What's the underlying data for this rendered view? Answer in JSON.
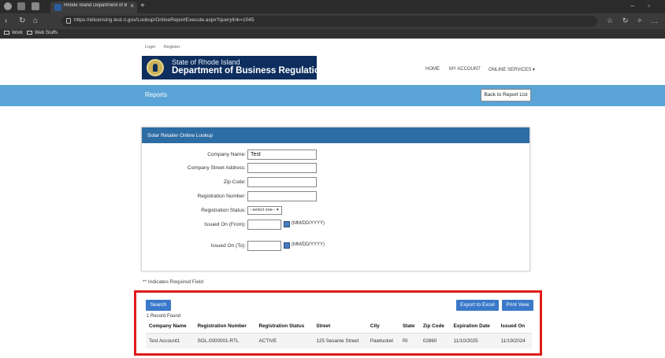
{
  "browser": {
    "tab_title": "Rhode Island Department of Busi",
    "url": "https://elicensing.test.ri.gov/Lookup/OnlineReportExecute.aspx?querylink=1045",
    "favorites": [
      "Work",
      "Web Stuffs"
    ]
  },
  "header": {
    "top_links": [
      "Login",
      "Register"
    ],
    "logo_line1": "State of Rhode Island",
    "logo_line2": "Department of Business Regulation",
    "nav": [
      "HOME",
      "MY ACCOUNT",
      "ONLINE SERVICES ▾"
    ]
  },
  "banner": {
    "title": "Reports",
    "back_label": "Back to Report List"
  },
  "form": {
    "heading": "Solar Retailer Online Lookup",
    "company_name_label": "Company Name:",
    "company_name_value": "Test",
    "street_label": "Company Street Address:",
    "zip_label": "Zip Code:",
    "reg_number_label": "Registration Number:",
    "reg_status_label": "Registration Status:",
    "reg_status_value": "--select one-- ▾",
    "issued_from_label": "Issued On (From):",
    "issued_to_label": "Issued On (To):",
    "date_format": "(MM/DD/YYYY)"
  },
  "required_note": "** Indicates Required Field",
  "results": {
    "search_label": "Search",
    "export_label": "Export to Excel",
    "print_label": "Print View",
    "record_count": "1 Record Found",
    "columns": [
      "Company Name",
      "Registration Number",
      "Registration Status",
      "Street",
      "City",
      "State",
      "Zip Code",
      "Expiration Date",
      "Issued On"
    ],
    "rows": [
      [
        "Test Account1",
        "SOL.0000001-RTL",
        "ACTIVE",
        "125 Sesame Street",
        "Pawtucket",
        "RI",
        "02860",
        "11/10/2025",
        "11/19/2024"
      ]
    ]
  },
  "colors": {
    "banner": "#5aa3d6",
    "panel_head": "#2e6da4",
    "button": "#3a79c9",
    "highlight": "#e11b1b",
    "logo_bg": "#0d2e5e"
  }
}
